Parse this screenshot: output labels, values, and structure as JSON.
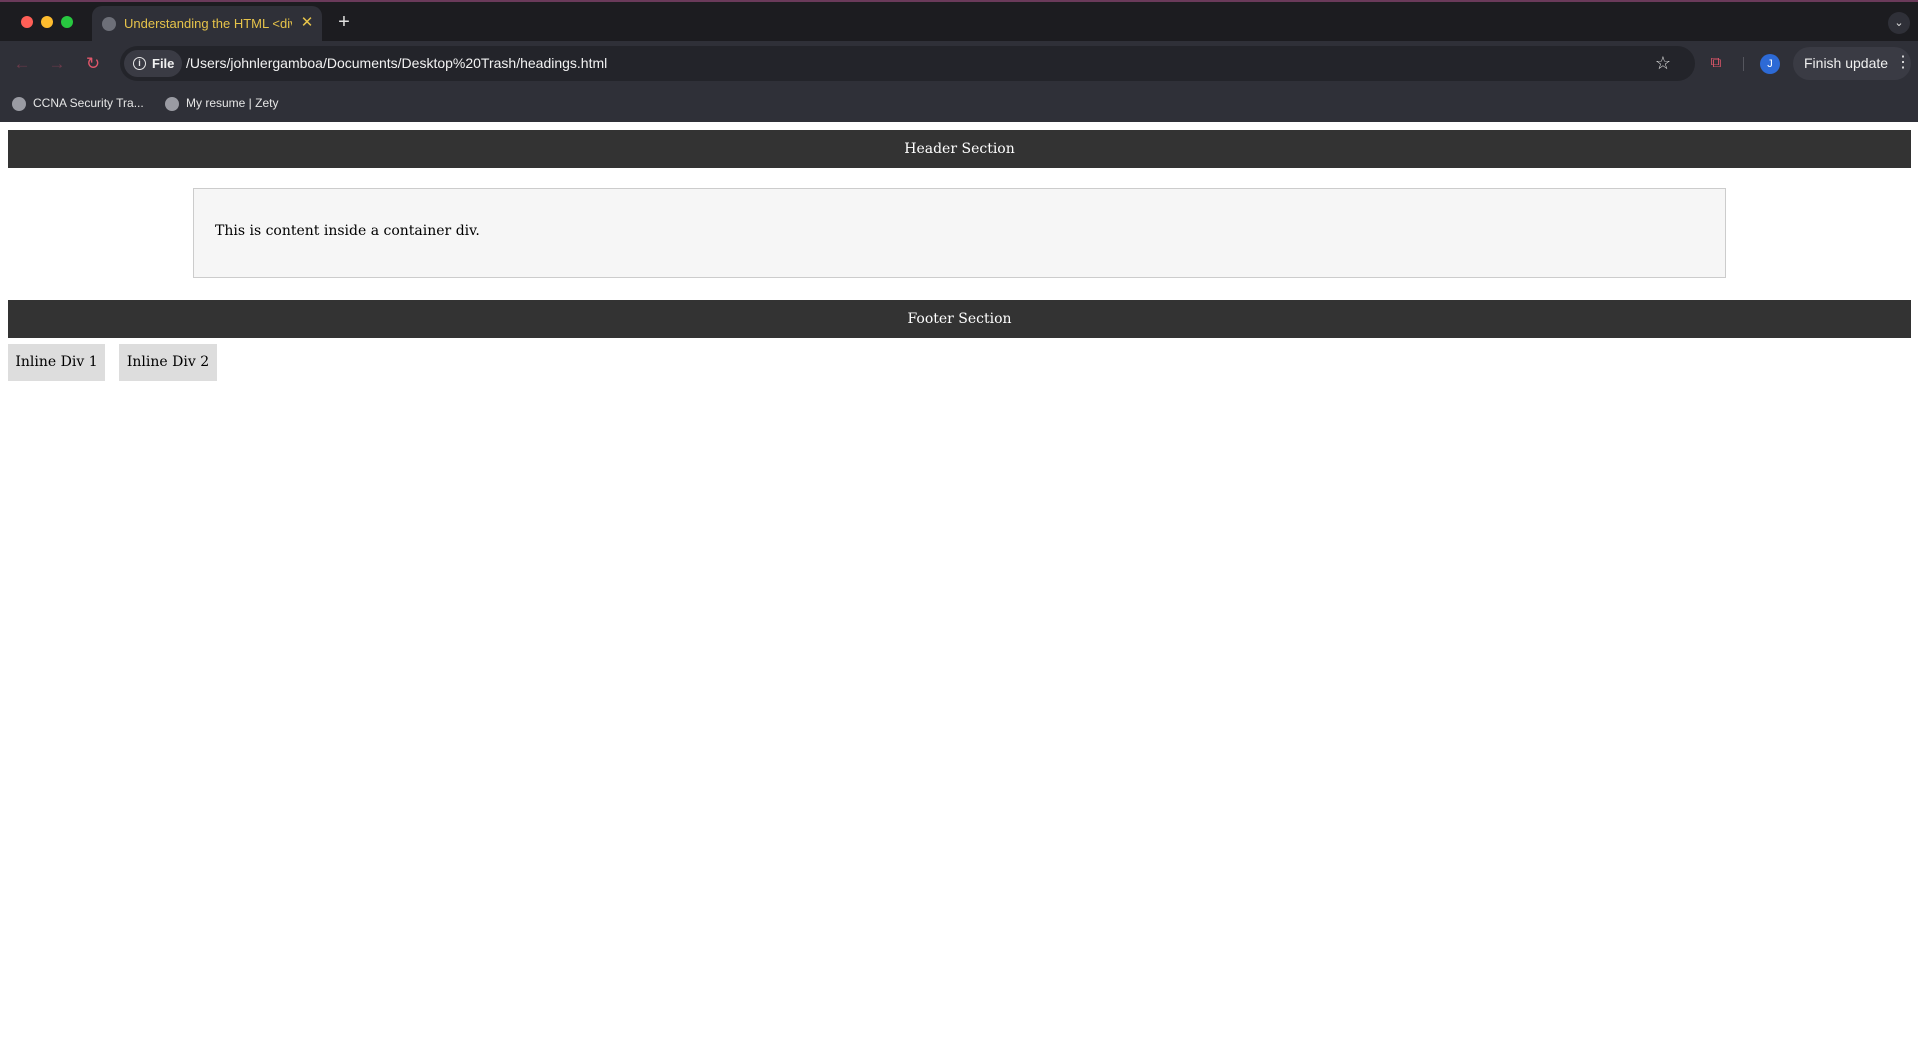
{
  "browser": {
    "tab": {
      "title": "Understanding the HTML <div"
    },
    "address": {
      "scheme_chip": "File",
      "url": "/Users/johnlergamboa/Documents/Desktop%20Trash/headings.html"
    },
    "profile_initial": "J",
    "finish_update_label": "Finish update",
    "icons": {
      "back": "back-arrow-icon",
      "forward": "forward-arrow-icon",
      "reload": "reload-icon",
      "star": "bookmark-star-icon",
      "extension": "extension-puzzle-icon",
      "menu": "kebab-menu-icon"
    },
    "bookmarks": [
      {
        "label": "CCNA Security Tra..."
      },
      {
        "label": "My resume | Zety"
      }
    ],
    "colors": {
      "tab_title": "#e6c34a",
      "avatar": "#2d6ad6"
    }
  },
  "page": {
    "header": "Header Section",
    "container_text": "This is content inside a container div.",
    "footer": "Footer Section",
    "inline_divs": [
      "Inline Div 1",
      "Inline Div 2"
    ],
    "colors": {
      "bar": "#333333",
      "container_bg": "#f6f6f6",
      "inline_bg": "#dddddd"
    }
  }
}
